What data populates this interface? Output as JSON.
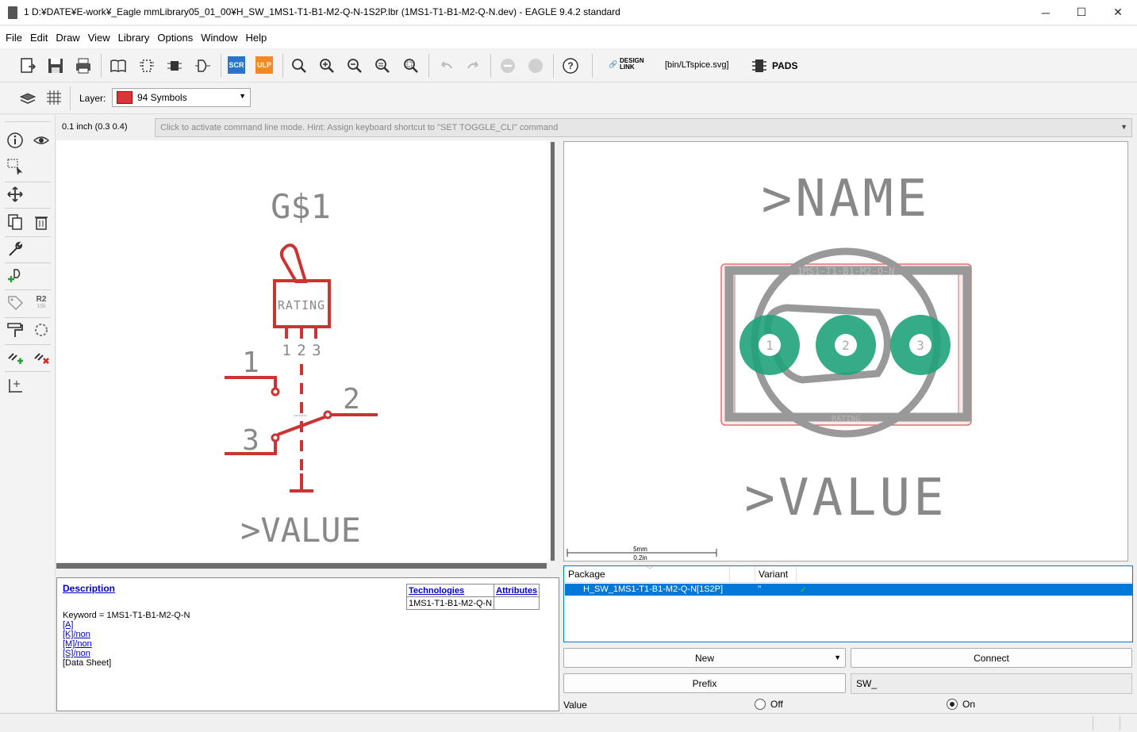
{
  "window": {
    "title": "1 D:¥DATE¥E-work¥_Eagle mmLibrary05_01_00¥H_SW_1MS1-T1-B1-M2-Q-N-1S2P.lbr (1MS1-T1-B1-M2-Q-N.dev) - EAGLE 9.4.2 standard",
    "minimize": "─",
    "maximize": "☐",
    "close": "✕"
  },
  "menu": {
    "items": [
      "File",
      "Edit",
      "Draw",
      "View",
      "Library",
      "Options",
      "Window",
      "Help"
    ]
  },
  "toolbar": {
    "scr_label": "SCR",
    "ulp_label": "ULP",
    "design_link_label": "DESIGN\nLINK",
    "ltspice_label": "[bin/LTspice.svg]",
    "pads_label": "PADS",
    "help_label": "?"
  },
  "layer": {
    "label": "Layer:",
    "selected": "94 Symbols",
    "color": "#d9363a"
  },
  "palette": {
    "r2_label": "R2",
    "r2_sub": "10k"
  },
  "coords": "0.1 inch (0.3 0.4)",
  "command_line": {
    "hint": "Click to activate command line mode. Hint: Assign keyboard shortcut to \"SET TOGGLE_CLI\" command"
  },
  "symbol": {
    "name": "G$1",
    "rating": "RATING",
    "top_pins": "1 2 3",
    "pin1": "1",
    "pin2": "2",
    "pin3": "3",
    "value": ">VALUE",
    "color": "#cc3333"
  },
  "package": {
    "name": ">NAME",
    "value": ">VALUE",
    "silk_text": "1MS1-T1-B1-M2-Q-N",
    "rating": "RATING",
    "pad_labels": [
      "1",
      "2",
      "3"
    ],
    "scale_top": "5mm",
    "scale_bottom": "0.2in",
    "pad_color": "#1fa37a"
  },
  "description": {
    "title": "Description",
    "keyword": "Keyword = 1MS1-T1-B1-M2-Q-N",
    "links": [
      "[A]",
      "[K]/non",
      "[M]/non",
      "[S]/non"
    ],
    "datasheet": "[Data Sheet]",
    "technologies_header": "Technologies",
    "attributes_header": "Attributes",
    "technology_value": "1MS1-T1-B1-M2-Q-N",
    "attribute_value": ""
  },
  "package_list": {
    "col_package": "Package",
    "col_variant": "Variant",
    "rows": [
      {
        "package": "H_SW_1MS1-T1-B1-M2-Q-N[1S2P]",
        "variant": "''",
        "check": "✓"
      }
    ]
  },
  "buttons": {
    "new": "New",
    "connect": "Connect",
    "prefix": "Prefix",
    "prefix_value": "SW_"
  },
  "value_option": {
    "label": "Value",
    "off": "Off",
    "on": "On",
    "selected": "On"
  }
}
